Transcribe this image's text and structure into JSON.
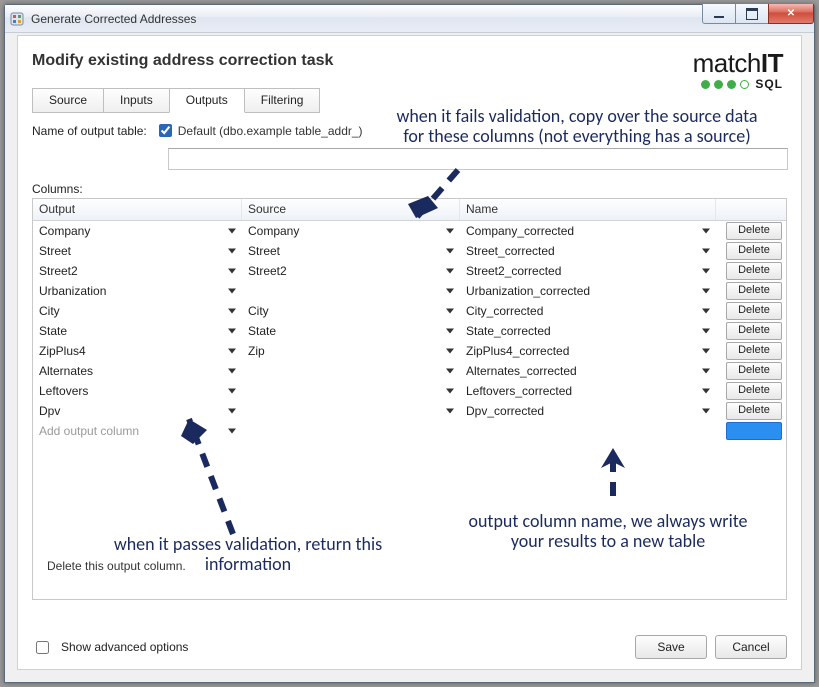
{
  "window": {
    "title": "Generate Corrected Addresses"
  },
  "header": {
    "title": "Modify existing address correction task"
  },
  "logo": {
    "brand_a": "match",
    "brand_b": "IT",
    "sub": "SQL"
  },
  "tabs": {
    "items": [
      {
        "label": "Source"
      },
      {
        "label": "Inputs"
      },
      {
        "label": "Outputs"
      },
      {
        "label": "Filtering"
      }
    ],
    "active_index": 2
  },
  "form": {
    "output_table_label": "Name of output table:",
    "default_checked": true,
    "default_label": "Default (dbo.example table_addr_)",
    "output_table_value": ""
  },
  "columns_label": "Columns:",
  "grid": {
    "headers": {
      "output": "Output",
      "source": "Source",
      "name": "Name"
    },
    "rows": [
      {
        "output": "Company",
        "source": "Company",
        "name": "Company_corrected"
      },
      {
        "output": "Street",
        "source": "Street",
        "name": "Street_corrected"
      },
      {
        "output": "Street2",
        "source": "Street2",
        "name": "Street2_corrected"
      },
      {
        "output": "Urbanization",
        "source": "",
        "name": "Urbanization_corrected"
      },
      {
        "output": "City",
        "source": "City",
        "name": "City_corrected"
      },
      {
        "output": "State",
        "source": "State",
        "name": "State_corrected"
      },
      {
        "output": "ZipPlus4",
        "source": "Zip",
        "name": "ZipPlus4_corrected"
      },
      {
        "output": "Alternates",
        "source": "",
        "name": "Alternates_corrected"
      },
      {
        "output": "Leftovers",
        "source": "",
        "name": "Leftovers_corrected"
      },
      {
        "output": "Dpv",
        "source": "",
        "name": "Dpv_corrected"
      }
    ],
    "delete_label": "Delete",
    "add_row_label": "Add output column"
  },
  "annotations": {
    "top": "when it fails validation, copy over the source data for these columns (not everything has a source)",
    "bottom_left": "when it passes validation, return this information",
    "bottom_right": "output column name, we always write your results to a new table"
  },
  "hint": "Delete this output column.",
  "footer": {
    "advanced_label": "Show advanced options",
    "save": "Save",
    "cancel": "Cancel"
  }
}
